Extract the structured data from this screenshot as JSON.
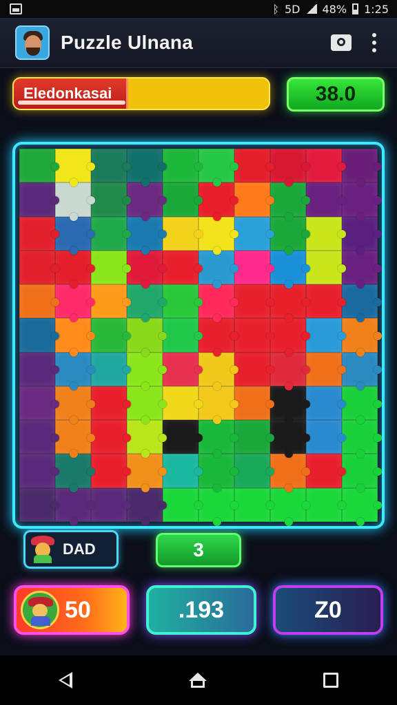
{
  "status_bar": {
    "signal_text": "5D",
    "battery_text": "48%",
    "time": "1:25"
  },
  "app": {
    "title": "Puzzle Ulnana"
  },
  "progress": {
    "label": "Eledonkasai",
    "fraction": 0.44
  },
  "score": "38.0",
  "board": {
    "columns": 10,
    "rows": 11,
    "colors": [
      [
        "#1fa83a",
        "#f0e61a",
        "#1a7a5a",
        "#12706a",
        "#1db83a",
        "#25c844",
        "#e41e2a",
        "#d81832",
        "#e21a3c",
        "#6a1e78"
      ],
      [
        "#5a2a7a",
        "#c9d9d0",
        "#1f8a4a",
        "#6a2a80",
        "#1aa838",
        "#e81e2a",
        "#ff7a1a",
        "#1aa83a",
        "#6a2080",
        "#6a2080"
      ],
      [
        "#e2202c",
        "#2a6ab0",
        "#1fa84a",
        "#1a7ab0",
        "#f2d21a",
        "#f2e21a",
        "#2aa0d8",
        "#1aa83a",
        "#c8e61a",
        "#5a2080"
      ],
      [
        "#e2202c",
        "#e41e2a",
        "#8ae61a",
        "#e21a3a",
        "#e8202c",
        "#2a9ad0",
        "#ff2a8a",
        "#1a90d8",
        "#c8e61a",
        "#6a2080"
      ],
      [
        "#f0701a",
        "#ff2a6a",
        "#ff9a1a",
        "#20a86a",
        "#28c83a",
        "#ff2a5a",
        "#e8202c",
        "#e8202a",
        "#e8202c",
        "#1a6aa0"
      ],
      [
        "#1a6a9a",
        "#ff8a1a",
        "#2ab83a",
        "#8ad81a",
        "#20c84a",
        "#e8202c",
        "#e8202c",
        "#e8202c",
        "#2a9ad8",
        "#f0801a"
      ],
      [
        "#5a2a7a",
        "#2a8ac0",
        "#20a8a0",
        "#8ae61a",
        "#e83050",
        "#f0c81a",
        "#e8202c",
        "#e02a3c",
        "#f0701a",
        "#2a8ac0"
      ],
      [
        "#6a2a80",
        "#f0801a",
        "#e8202c",
        "#8ae61a",
        "#f0d81a",
        "#f2c81a",
        "#f0701a",
        "#1a1a1a",
        "#2a8ad0",
        "#1ad03a"
      ],
      [
        "#5a2a7a",
        "#f0801a",
        "#e8202c",
        "#b8e61a",
        "#1a1a1a",
        "#1ab83a",
        "#1aa83a",
        "#1a1a1a",
        "#2a8ad0",
        "#1ad03a"
      ],
      [
        "#5a2a7a",
        "#1a7a6a",
        "#e8202c",
        "#f0901a",
        "#1ab8a0",
        "#1ab83a",
        "#1aa85a",
        "#f0701a",
        "#e8202c",
        "#1ad03a"
      ],
      [
        "#4a2a6a",
        "#5a2a7a",
        "#5a2a7a",
        "#4a2a6a",
        "#1ad83a",
        "#1ad83a",
        "#1ad83a",
        "#1ad83a",
        "#1ad83a",
        "#1ad83a"
      ]
    ]
  },
  "player": {
    "name": "DAD"
  },
  "moves": "3",
  "stats": {
    "coins": "50",
    "time": ".193",
    "level": "Z0"
  }
}
